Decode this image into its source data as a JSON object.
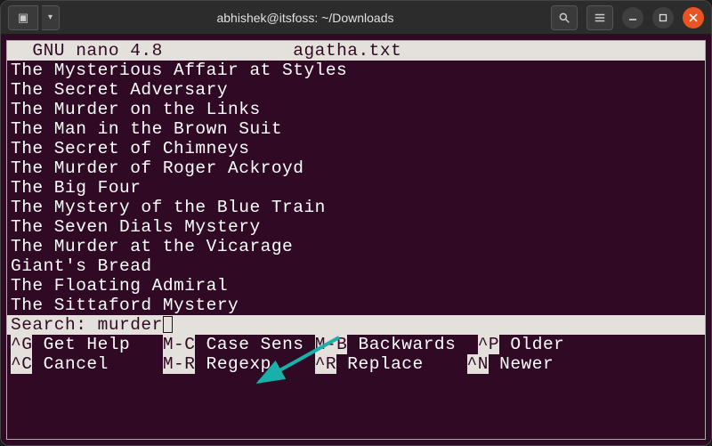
{
  "window": {
    "title": "abhishek@itsfoss: ~/Downloads"
  },
  "editor": {
    "header_app": "  GNU nano 4.8",
    "header_file": "agatha.txt",
    "lines": [
      "The Mysterious Affair at Styles",
      "The Secret Adversary",
      "The Murder on the Links",
      "The Man in the Brown Suit",
      "The Secret of Chimneys",
      "The Murder of Roger Ackroyd",
      "The Big Four",
      "The Mystery of the Blue Train",
      "The Seven Dials Mystery",
      "The Murder at the Vicarage",
      "Giant's Bread",
      "The Floating Admiral",
      "The Sittaford Mystery"
    ],
    "search_prompt": "Search: ",
    "search_value": "murder",
    "shortcuts_row1": [
      {
        "key": "^G",
        "label": " Get Help  "
      },
      {
        "key": "M-C",
        "label": " Case Sens"
      },
      {
        "key": "M-B",
        "label": " Backwards "
      },
      {
        "key": "^P",
        "label": " Older"
      }
    ],
    "shortcuts_row2": [
      {
        "key": "^C",
        "label": " Cancel    "
      },
      {
        "key": "M-R",
        "label": " Regexp   "
      },
      {
        "key": "^R",
        "label": " Replace   "
      },
      {
        "key": "^N",
        "label": " Newer"
      }
    ]
  }
}
